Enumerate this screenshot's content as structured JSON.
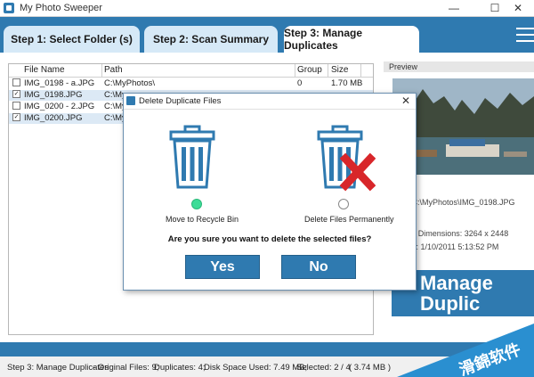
{
  "window": {
    "title": "My Photo Sweeper"
  },
  "tabs": [
    {
      "label": "Step 1: Select Folder (s)"
    },
    {
      "label": "Step 2: Scan Summary"
    },
    {
      "label": "Step 3: Manage Duplicates"
    }
  ],
  "file_list": {
    "columns": [
      "File Name",
      "Path",
      "Group",
      "Size"
    ],
    "rows": [
      {
        "checked": false,
        "name": "IMG_0198 - a.JPG",
        "path": "C:\\MyPhotos\\",
        "group": "0",
        "size": "1.70 MB"
      },
      {
        "checked": true,
        "name": "IMG_0198.JPG",
        "path": "C:\\My",
        "group": "",
        "size": ""
      },
      {
        "checked": false,
        "name": "IMG_0200 - 2.JPG",
        "path": "C:\\My",
        "group": "",
        "size": ""
      },
      {
        "checked": true,
        "name": "IMG_0200.JPG",
        "path": "C:\\My",
        "group": "",
        "size": ""
      }
    ]
  },
  "preview": {
    "header": "Preview",
    "path": "C:\\MyPhotos\\IMG_0198.JPG",
    "dimensions": "Dimensions: 3264 x 2448",
    "modified": "odified: 1/10/2011 5:13:52 PM"
  },
  "banner": {
    "line1": "Manage",
    "line2": "Duplic"
  },
  "status": {
    "step": "Step 3: Manage Duplicates",
    "original": "- Original Files: 9;",
    "duplicates": "Duplicates: 4;",
    "disk": "Disk Space Used: 7.49 MB;",
    "selected": "Selected: 2 / 4",
    "selected_size": "( 3.74 MB )"
  },
  "dialog": {
    "title": "Delete Duplicate Files",
    "option_recycle": "Move to Recycle Bin",
    "option_delete": "Delete Files Permanently",
    "selected_option": "recycle",
    "question": "Are you sure you want to delete the selected files?",
    "yes": "Yes",
    "no": "No"
  },
  "watermark": {
    "text": "滑錦软件"
  },
  "colors": {
    "accent": "#2f7ab0",
    "tab_inactive": "#d6e9f7",
    "radio_selected": "#3ddc97",
    "delete_x": "#d8262a"
  }
}
